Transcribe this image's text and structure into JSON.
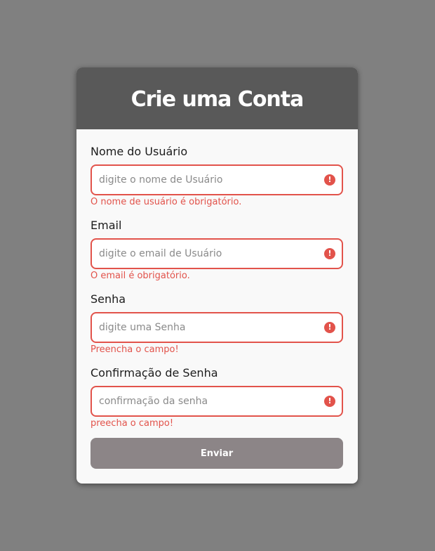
{
  "title": "Crie uma Conta",
  "fields": [
    {
      "label": "Nome do Usuário",
      "placeholder": "digite o nome de Usuário",
      "value": "",
      "error": "O nome de usuário é obrigatório."
    },
    {
      "label": "Email",
      "placeholder": "digite o email de Usuário",
      "value": "",
      "error": "O email é obrigatório."
    },
    {
      "label": "Senha",
      "placeholder": "digite uma Senha",
      "value": "",
      "error": "Preencha o campo!"
    },
    {
      "label": "Confirmação de Senha",
      "placeholder": "confirmação da senha",
      "value": "",
      "error": "preecha o campo!"
    }
  ],
  "submit_label": "Enviar",
  "icons": {
    "error": "exclamation-circle-icon",
    "error_glyph": "!"
  },
  "colors": {
    "page_bg": "#808080",
    "header_bg": "#595959",
    "card_bg": "#f9f9f9",
    "error": "#e2534b",
    "button_bg": "#8c8587"
  }
}
